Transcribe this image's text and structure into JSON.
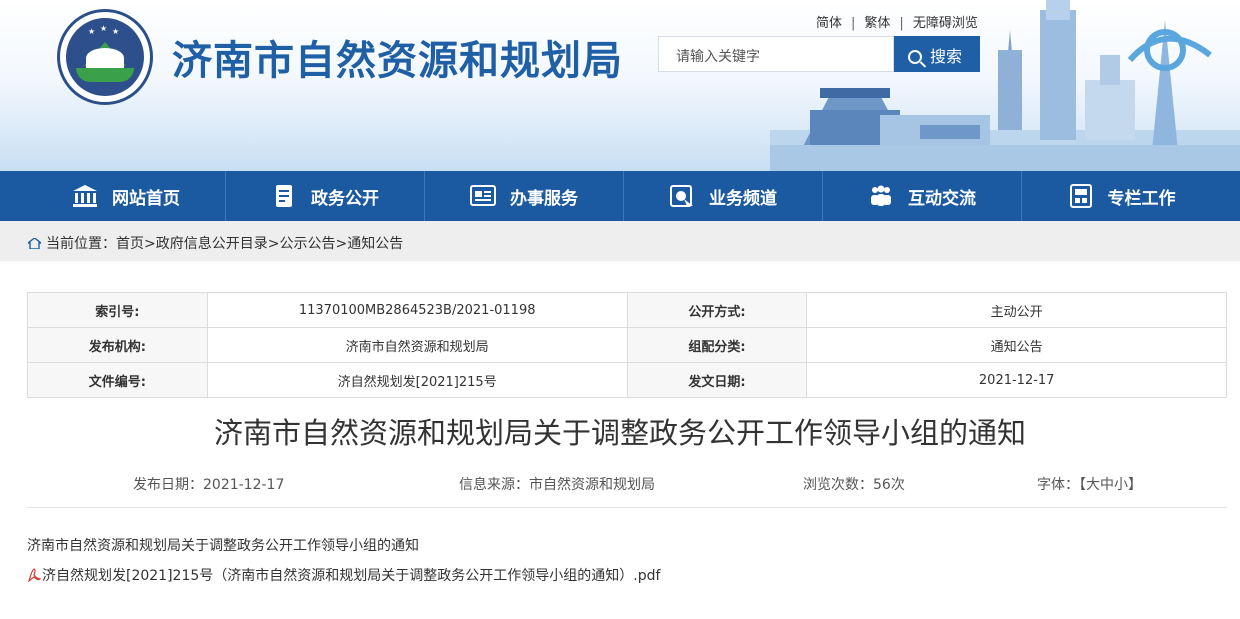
{
  "site": {
    "title": "济南市自然资源和规划局",
    "logo_icon": "bureau-emblem-icon"
  },
  "top_links": [
    "简体",
    "繁体",
    "无障碍浏览"
  ],
  "top_links_sep": "|",
  "search": {
    "placeholder": "请输入关键字",
    "button_label": "搜索"
  },
  "nav": [
    {
      "label": "网站首页",
      "icon": "building-icon"
    },
    {
      "label": "政务公开",
      "icon": "document-icon"
    },
    {
      "label": "办事服务",
      "icon": "service-form-icon"
    },
    {
      "label": "业务频道",
      "icon": "channel-icon"
    },
    {
      "label": "互动交流",
      "icon": "people-icon"
    },
    {
      "label": "专栏工作",
      "icon": "column-icon"
    }
  ],
  "breadcrumb": {
    "prefix": "当前位置：",
    "items": [
      "首页",
      "政府信息公开目录",
      "公示公告",
      "通知公告"
    ],
    "sep": ">"
  },
  "meta": {
    "index_label": "索引号:",
    "index_value": "11370100MB2864523B/2021-01198",
    "open_label": "公开方式:",
    "open_value": "主动公开",
    "org_label": "发布机构:",
    "org_value": "济南市自然资源和规划局",
    "category_label": "组配分类:",
    "category_value": "通知公告",
    "docno_label": "文件编号:",
    "docno_value": "济自然规划发[2021]215号",
    "date_label": "发文日期:",
    "date_value": "2021-12-17"
  },
  "article": {
    "title": "济南市自然资源和规划局关于调整政务公开工作领导小组的通知",
    "publish_date": "发布日期：2021-12-17",
    "source": "信息来源：市自然资源和规划局",
    "views": "浏览次数：56次",
    "font_label": "字体：",
    "font_open": "【",
    "font_large": "大",
    "font_medium": "中",
    "font_small": "小",
    "font_close": "】",
    "body_text": "济南市自然资源和规划局关于调整政务公开工作领导小组的通知",
    "attachment": "济自然规划发[2021]215号（济南市自然资源和规划局关于调整政务公开工作领导小组的通知）.pdf"
  },
  "colors": {
    "brand": "#1f5fa6",
    "nav_bg": "#1b5aa0"
  }
}
